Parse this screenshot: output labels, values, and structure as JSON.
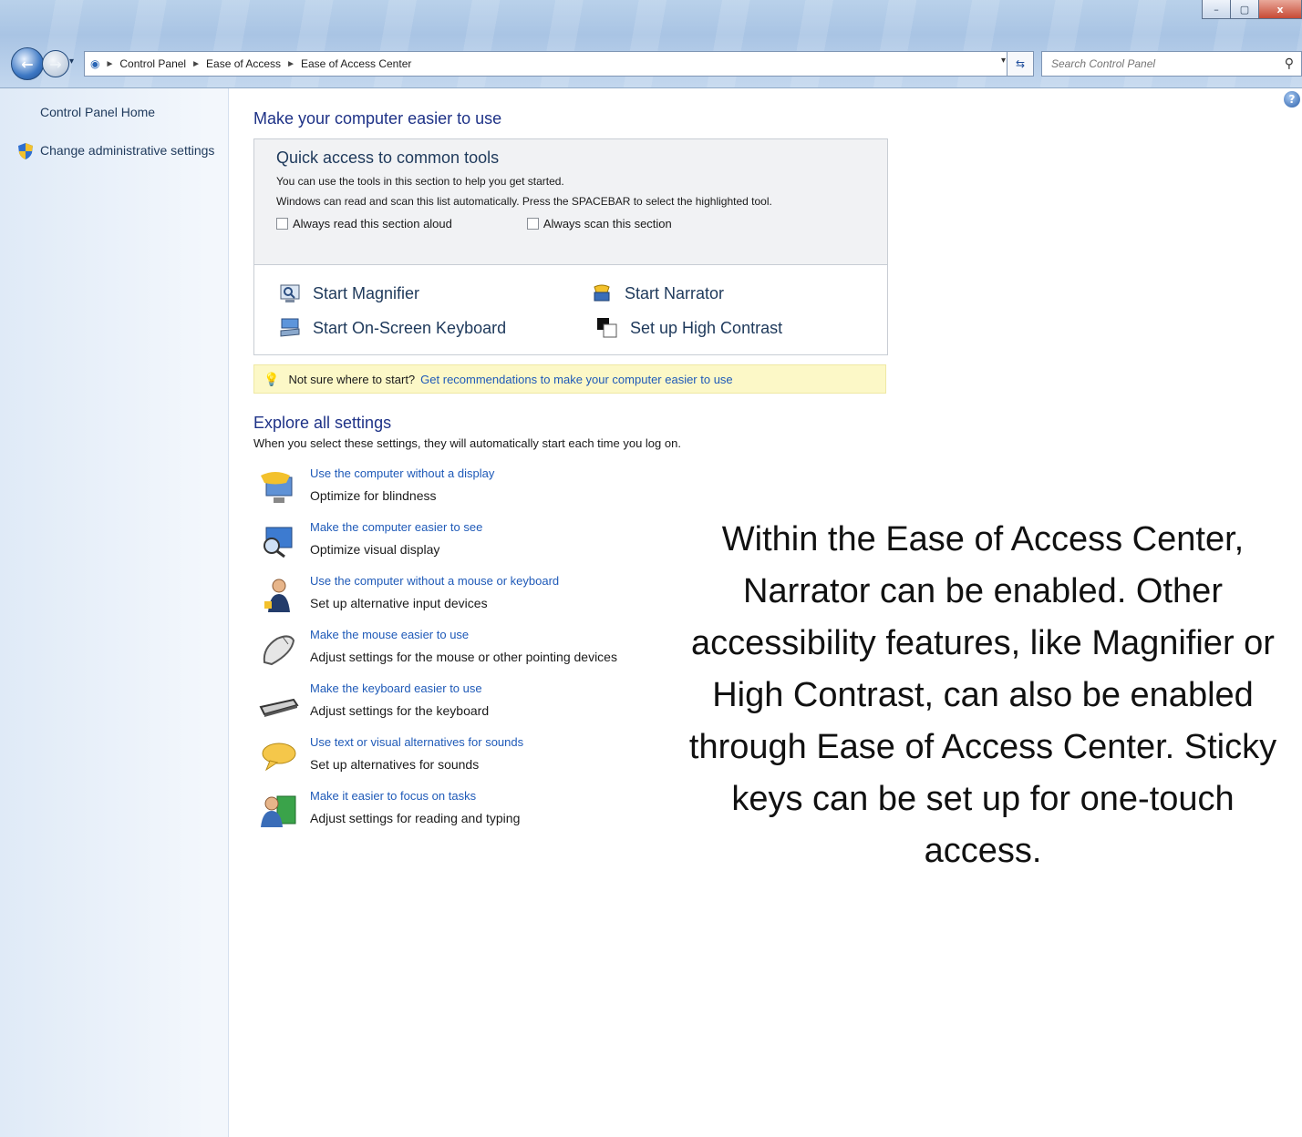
{
  "window": {
    "minimize_label": "–",
    "maximize_label": "▢",
    "close_label": "x"
  },
  "address": {
    "crumbs": [
      "Control Panel",
      "Ease of Access",
      "Ease of Access Center"
    ],
    "search_placeholder": "Search Control Panel"
  },
  "sidebar": {
    "home": "Control Panel Home",
    "admin": "Change administrative settings"
  },
  "main": {
    "title": "Make your computer easier to use",
    "quick": {
      "heading": "Quick access to common tools",
      "line1": "You can use the tools in this section to help you get started.",
      "line2": "Windows can read and scan this list automatically.  Press the SPACEBAR to select the highlighted tool.",
      "checkbox_read": "Always read this section aloud",
      "checkbox_scan": "Always scan this section",
      "tools": [
        "Start Magnifier",
        "Start Narrator",
        "Start On-Screen Keyboard",
        "Set up High Contrast"
      ]
    },
    "hint": {
      "text": "Not sure where to start?",
      "link": "Get recommendations to make your computer easier to use"
    },
    "explore": {
      "heading": "Explore all settings",
      "subtitle": "When you select these settings, they will automatically start each time you log on.",
      "items": [
        {
          "link": "Use the computer without a display",
          "desc": "Optimize for blindness",
          "icon": "display-speech-icon"
        },
        {
          "link": "Make the computer easier to see",
          "desc": "Optimize visual display",
          "icon": "magnify-monitor-icon"
        },
        {
          "link": "Use the computer without a mouse or keyboard",
          "desc": "Set up alternative input devices",
          "icon": "user-input-icon"
        },
        {
          "link": "Make the mouse easier to use",
          "desc": "Adjust settings for the mouse or other pointing devices",
          "icon": "mouse-icon"
        },
        {
          "link": "Make the keyboard easier to use",
          "desc": "Adjust settings for the keyboard",
          "icon": "keyboard-icon"
        },
        {
          "link": "Use text or visual alternatives for sounds",
          "desc": "Set up alternatives for sounds",
          "icon": "speech-bubble-icon"
        },
        {
          "link": "Make it easier to focus on tasks",
          "desc": "Adjust settings for reading and typing",
          "icon": "focus-tasks-icon"
        }
      ]
    }
  },
  "note": "Within the Ease of Access Center, Narrator can be enabled.  Other accessibility features, like Magnifier or High Contrast, can also be enabled through Ease of Access Center.  Sticky keys can be set up for one-touch access."
}
